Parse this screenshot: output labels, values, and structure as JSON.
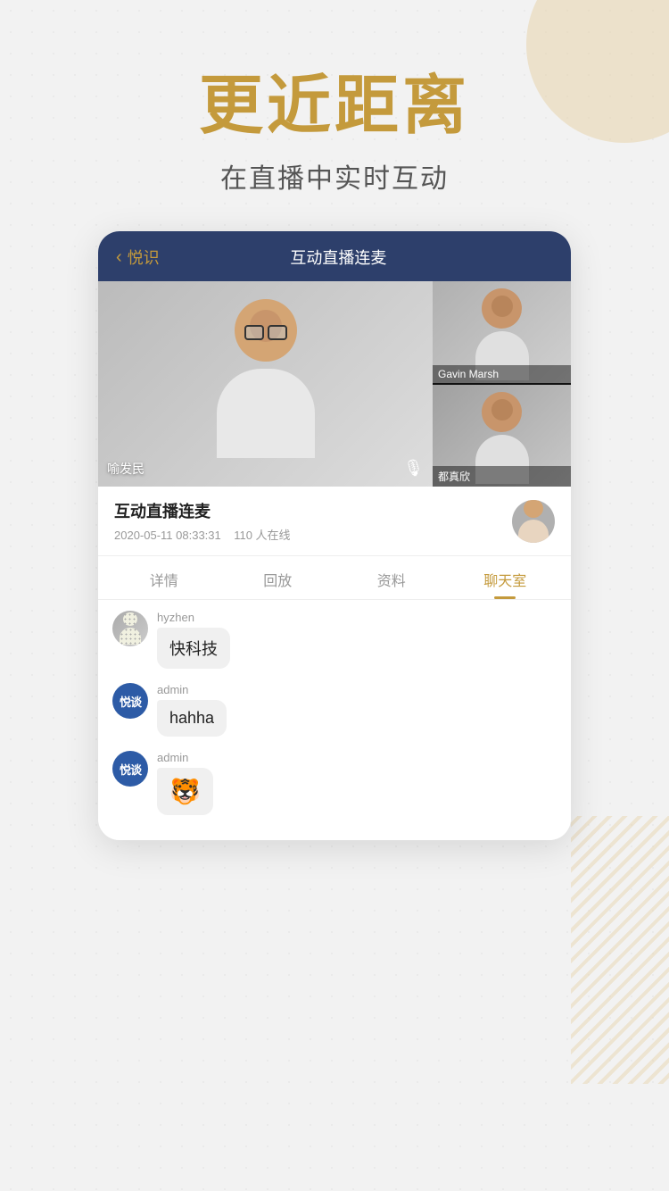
{
  "background": {
    "dot_color": "#ccc"
  },
  "hero": {
    "title": "更近距离",
    "subtitle": "在直播中实时互动"
  },
  "app": {
    "header": {
      "back_label": "悦识",
      "title": "互动直播连麦"
    },
    "video": {
      "main_speaker": "喻发民",
      "side_speakers": [
        "Gavin Marsh",
        "都真欣"
      ]
    },
    "info": {
      "title": "互动直播连麦",
      "date": "2020-05-11 08:33:31",
      "online": "110 人在线"
    },
    "tabs": [
      "详情",
      "回放",
      "资料",
      "聊天室"
    ],
    "active_tab": 3,
    "chat": [
      {
        "username": "hyzhen",
        "message": "快科技",
        "type": "text"
      },
      {
        "username": "admin",
        "message": "hahha",
        "type": "text"
      },
      {
        "username": "admin",
        "message": "🐯",
        "type": "emoji"
      }
    ]
  }
}
